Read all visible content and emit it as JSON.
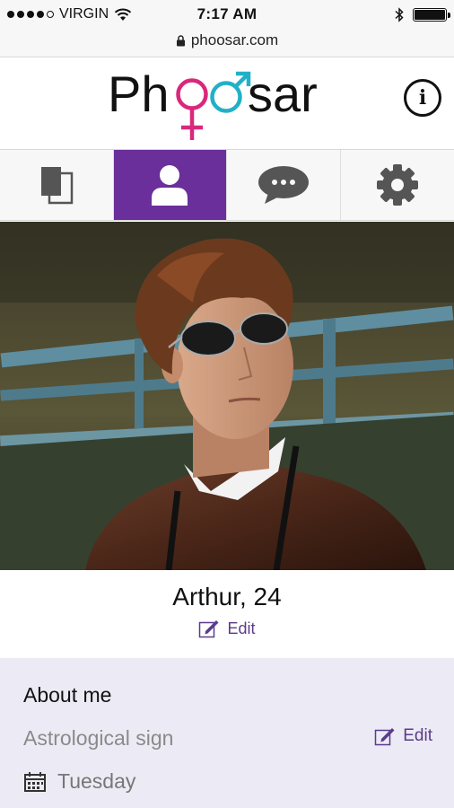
{
  "status_bar": {
    "carrier": "VIRGIN",
    "time": "7:17 AM"
  },
  "url_bar": {
    "url": "phoosar.com"
  },
  "header": {
    "logo_text": "Phoosar",
    "info_label": "i"
  },
  "tabs": [
    {
      "name": "cards",
      "icon": "cards-icon",
      "active": false
    },
    {
      "name": "profile",
      "icon": "user-icon",
      "active": true
    },
    {
      "name": "messages",
      "icon": "chat-bubble-icon",
      "active": false
    },
    {
      "name": "settings",
      "icon": "gear-icon",
      "active": false
    }
  ],
  "profile": {
    "name": "Arthur, 24",
    "edit_label": "Edit"
  },
  "about": {
    "title": "About me",
    "astrological_label": "Astrological sign",
    "edit_label": "Edit",
    "birthday_value": "Tuesday"
  },
  "colors": {
    "accent": "#6a2f9a",
    "link": "#5b3b8c",
    "logo_pink": "#d9287c",
    "logo_teal": "#22b0c8",
    "about_bg": "#ecebf5"
  }
}
